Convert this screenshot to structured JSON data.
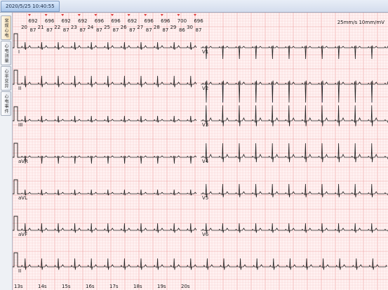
{
  "window": {
    "datetime": "2020/5/25 10:40:55"
  },
  "sidebar": {
    "tabs": [
      {
        "label": "常规心电",
        "active": true
      },
      {
        "label": "心电测量",
        "active": false
      },
      {
        "label": "心率变异",
        "active": false
      },
      {
        "label": "心电事件",
        "active": false
      }
    ]
  },
  "scale": {
    "text": "25mm/s 10mm/mV"
  },
  "beats": [
    {
      "index": "20",
      "rr": "692",
      "hr": "87"
    },
    {
      "index": "21",
      "rr": "696",
      "hr": "87"
    },
    {
      "index": "22",
      "rr": "692",
      "hr": "87"
    },
    {
      "index": "23",
      "rr": "692",
      "hr": "87"
    },
    {
      "index": "24",
      "rr": "696",
      "hr": "87"
    },
    {
      "index": "25",
      "rr": "696",
      "hr": "87"
    },
    {
      "index": "26",
      "rr": "692",
      "hr": "87"
    },
    {
      "index": "27",
      "rr": "696",
      "hr": "87"
    },
    {
      "index": "28",
      "rr": "696",
      "hr": "87"
    },
    {
      "index": "29",
      "rr": "700",
      "hr": "86"
    },
    {
      "index": "30",
      "rr": "696",
      "hr": "87"
    }
  ],
  "leads_left": [
    "I",
    "II",
    "III",
    "aVR",
    "aVL",
    "aVF",
    "II"
  ],
  "leads_right": [
    "V1",
    "V2",
    "V3",
    "V4",
    "V5",
    "V6"
  ],
  "time_ticks": [
    "13s",
    "14s",
    "15s",
    "16s",
    "17s",
    "18s",
    "19s",
    "20s"
  ],
  "colors": {
    "grid_minor": "#f6cccc",
    "grid_major": "#ee9d9d",
    "trace": "#222222",
    "marker": "#e03a3a",
    "highlight": "#5a6ad8"
  }
}
